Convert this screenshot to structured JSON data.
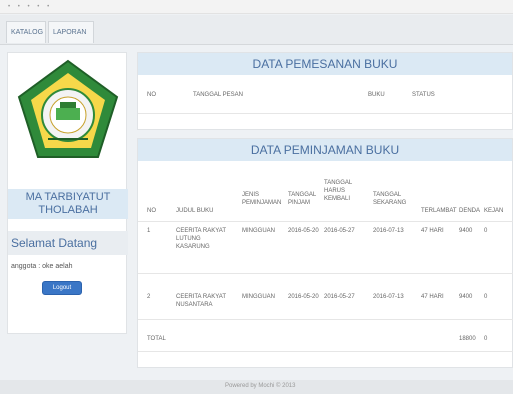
{
  "tabs": [
    "KATALOG",
    "LAPORAN"
  ],
  "sidebar": {
    "school_name": "MA TARBIYATUT THOLABAH",
    "welcome": "Selamat Datang",
    "member_text": "anggota : oke aelah",
    "logout_label": "Logout"
  },
  "order_panel": {
    "title": "DATA PEMESANAN BUKU",
    "headers": [
      "NO",
      "TANGGAL PESAN",
      "BUKU",
      "STATUS"
    ]
  },
  "loan_panel": {
    "title": "DATA PEMINJAMAN BUKU",
    "headers": [
      "NO",
      "JUDUL BUKU",
      "JENIS PEMINJAMAN",
      "TANGGAL PINJAM",
      "TANGGAL HARUS KEMBALI",
      "TANGGAL SEKARANG",
      "TERLAMBAT",
      "DENDA",
      "KEJAN"
    ],
    "rows": [
      [
        "1",
        "CEERITA RAKYAT LUTUNG KASARUNG",
        "MINGGUAN",
        "2016-05-20",
        "2016-05-27",
        "2016-07-13",
        "47 HARI",
        "9400",
        "0"
      ],
      [
        "2",
        "CEERITA RAKYAT NUSANTARA",
        "MINGGUAN",
        "2016-05-20",
        "2016-05-27",
        "2016-07-13",
        "47 HARI",
        "9400",
        "0"
      ]
    ],
    "total_label": "TOTAL",
    "total_values": [
      "18800",
      "0"
    ]
  },
  "footer_text": "Powered by Mochi © 2013"
}
